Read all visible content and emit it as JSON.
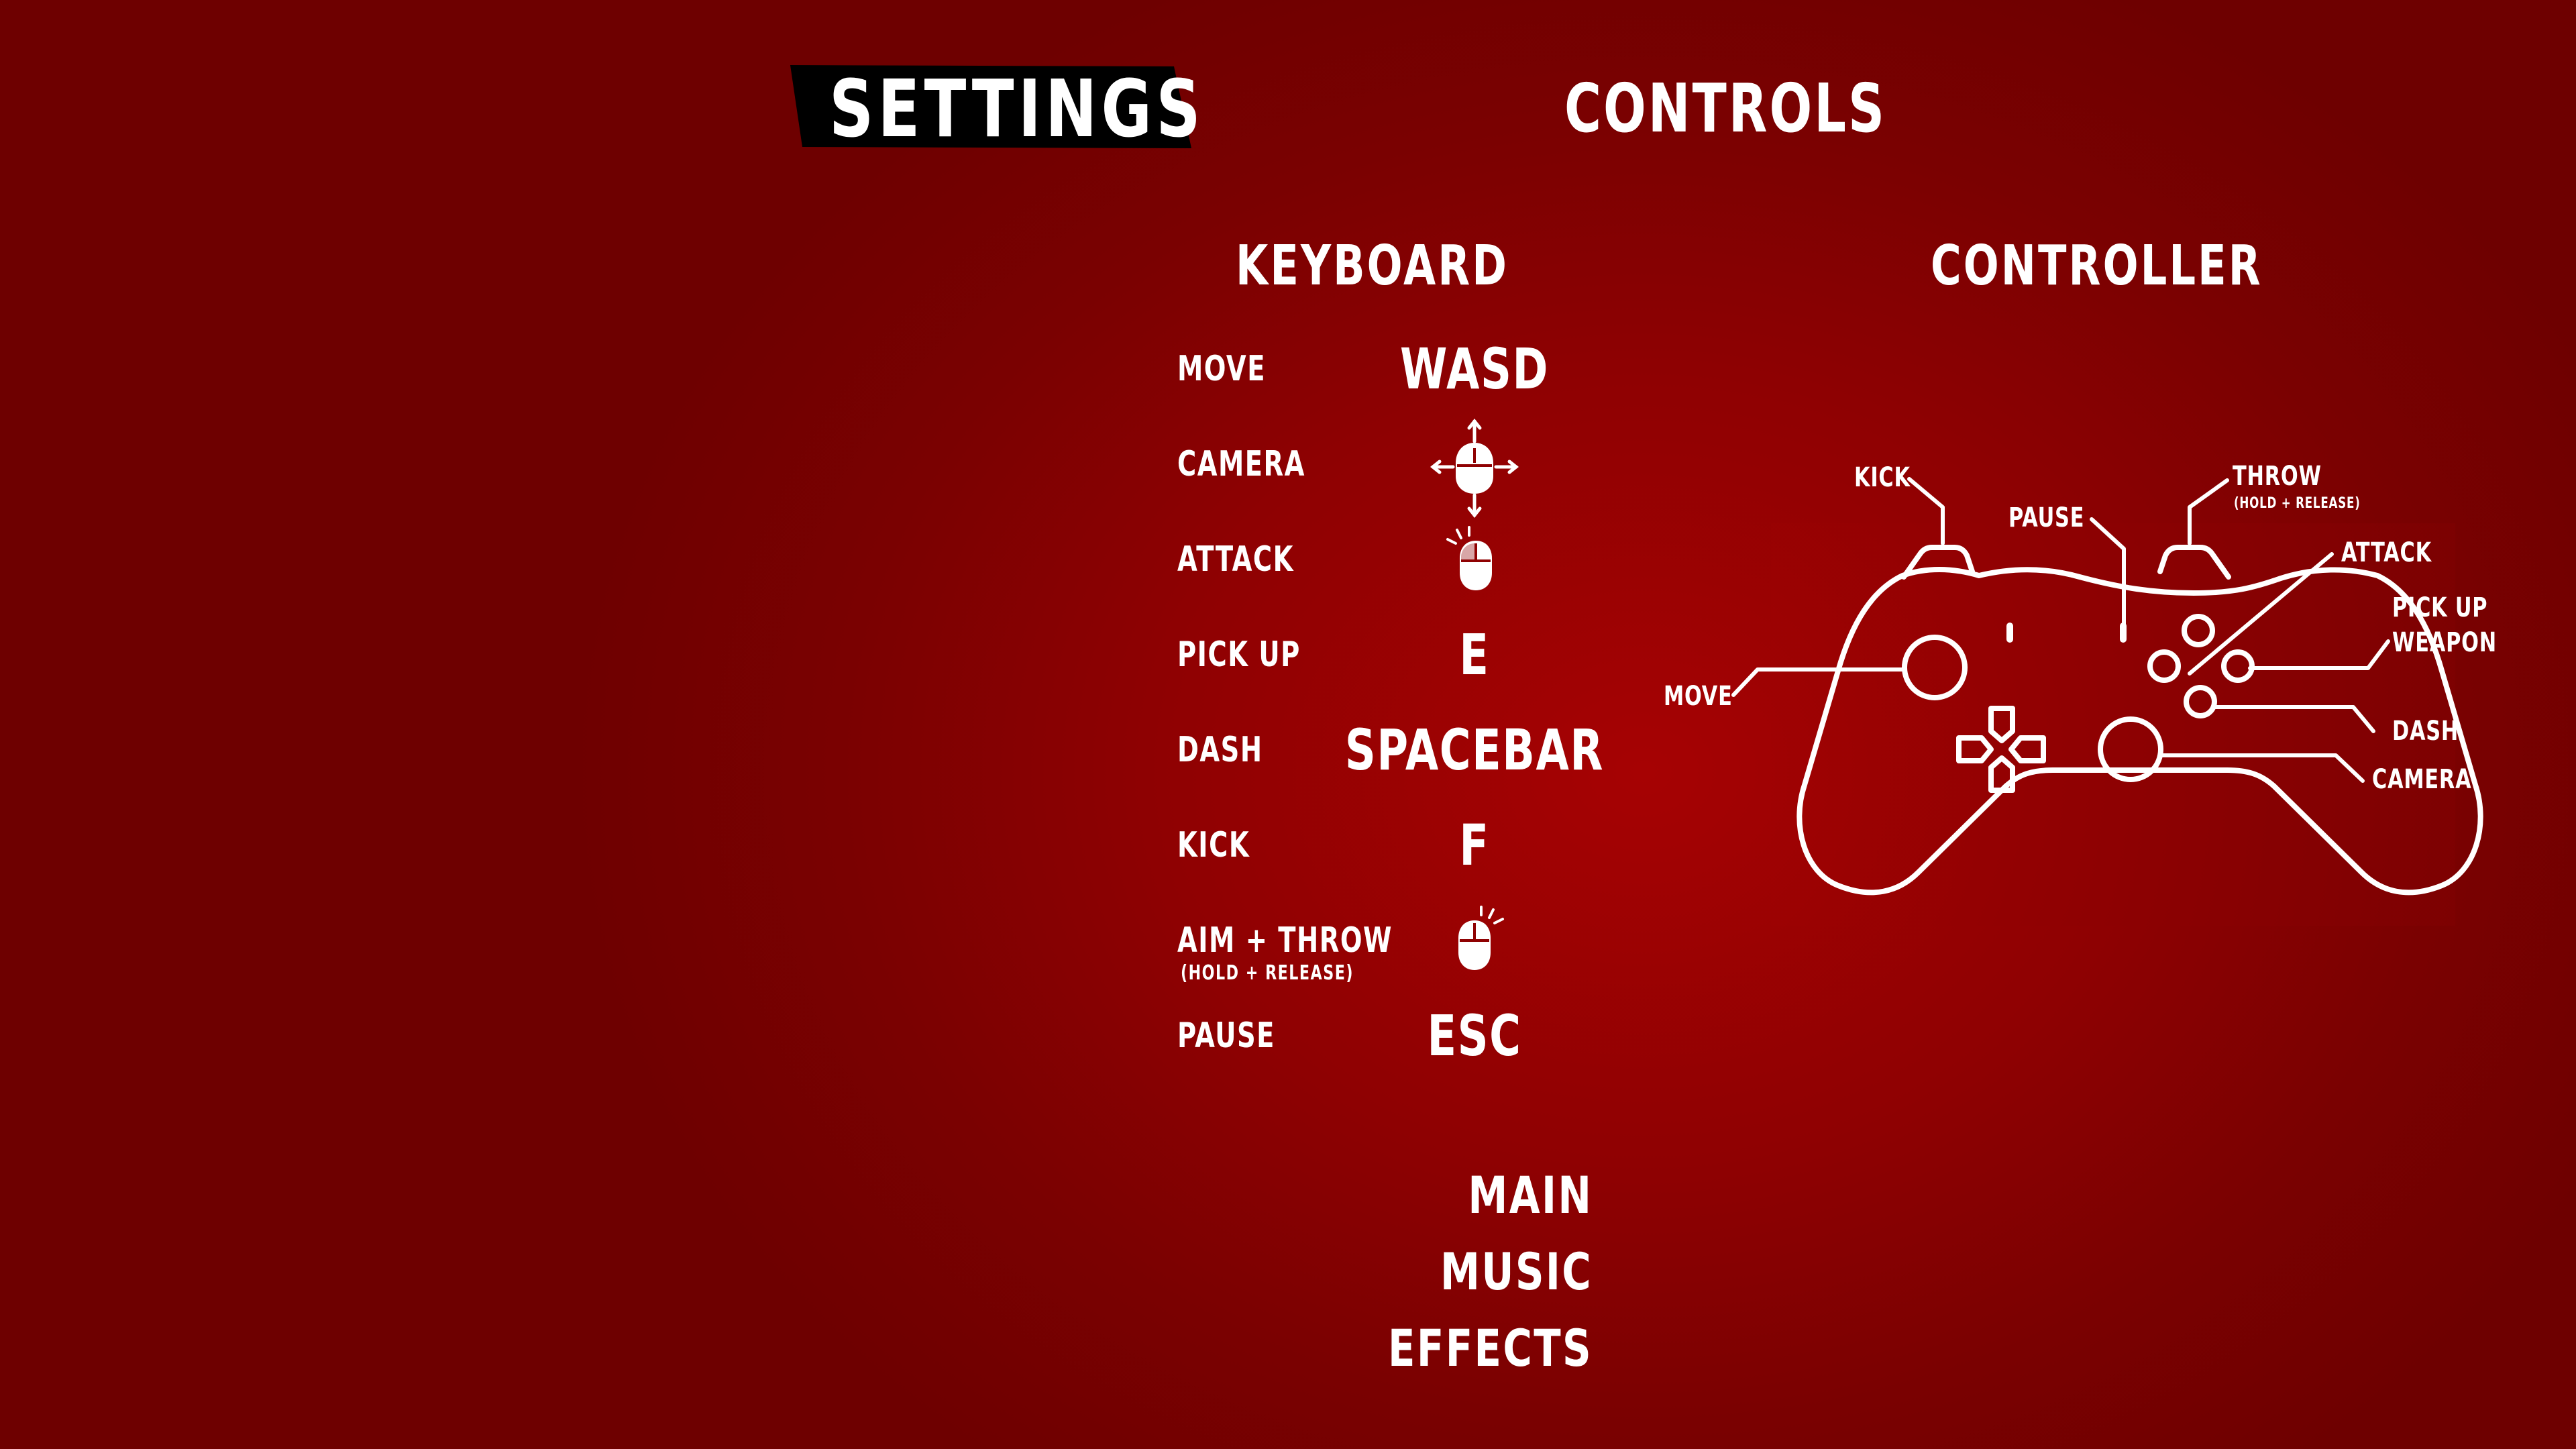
{
  "header": {
    "settings_title": "SETTINGS",
    "controls_title": "CONTROLS"
  },
  "keyboard": {
    "title": "KEYBOARD",
    "rows": [
      {
        "label": "MOVE",
        "binding": "WASD",
        "icon": null
      },
      {
        "label": "CAMERA",
        "binding": null,
        "icon": "mouse-move-icon"
      },
      {
        "label": "ATTACK",
        "binding": null,
        "icon": "mouse-left-click-icon"
      },
      {
        "label": "PICK UP",
        "binding": "E",
        "icon": null
      },
      {
        "label": "DASH",
        "binding": "SPACEBAR",
        "icon": null
      },
      {
        "label": "KICK",
        "binding": "F",
        "icon": null
      },
      {
        "label": "AIM + THROW",
        "sublabel": "(HOLD + RELEASE)",
        "binding": null,
        "icon": "mouse-right-click-icon"
      },
      {
        "label": "PAUSE",
        "binding": "ESC",
        "icon": null
      }
    ]
  },
  "controller": {
    "title": "CONTROLLER",
    "labels": {
      "kick": "KICK",
      "pause": "PAUSE",
      "throw": "THROW",
      "throw_sub": "(HOLD + RELEASE)",
      "attack": "ATTACK",
      "pick_up_1": "PICK UP",
      "pick_up_2": "WEAPON",
      "move": "MOVE",
      "dash": "DASH",
      "camera": "CAMERA"
    }
  },
  "menu": {
    "items": [
      "MAIN",
      "MUSIC",
      "EFFECTS"
    ]
  },
  "colors": {
    "background": "#8f0102",
    "text": "#ffffff",
    "banner": "#000000"
  }
}
